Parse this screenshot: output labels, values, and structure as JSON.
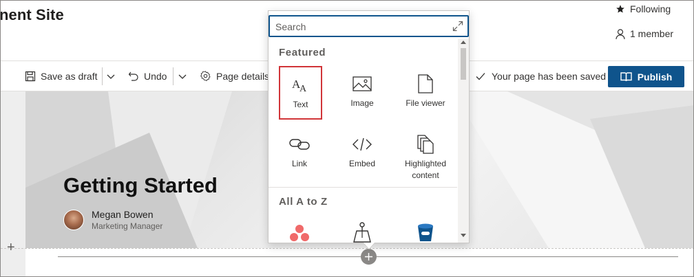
{
  "header": {
    "site_title": "nent Site",
    "following_label": "Following",
    "members_label": "1 member"
  },
  "command_bar": {
    "save_draft_label": "Save as draft",
    "undo_label": "Undo",
    "page_details_label": "Page details",
    "status_text": "Your page has been saved",
    "publish_label": "Publish"
  },
  "page": {
    "title": "Getting Started",
    "author_name": "Megan Bowen",
    "author_role": "Marketing Manager"
  },
  "toolbox": {
    "search_placeholder": "Search",
    "featured_label": "Featured",
    "featured_items": [
      {
        "label": "Text",
        "icon": "text-icon",
        "selected": true
      },
      {
        "label": "Image",
        "icon": "image-icon"
      },
      {
        "label": "File viewer",
        "icon": "file-icon"
      },
      {
        "label": "Link",
        "icon": "link-icon"
      },
      {
        "label": "Embed",
        "icon": "embed-icon"
      },
      {
        "label": "Highlighted content",
        "icon": "highlighted-content-icon"
      }
    ],
    "all_label": "All A to Z",
    "all_items": [
      {
        "icon": "asana-icon"
      },
      {
        "icon": "bing-maps-icon"
      },
      {
        "icon": "bucket-icon"
      }
    ]
  },
  "colors": {
    "accent": "#0f548c",
    "selection": "#d13438",
    "text": "#323130"
  }
}
